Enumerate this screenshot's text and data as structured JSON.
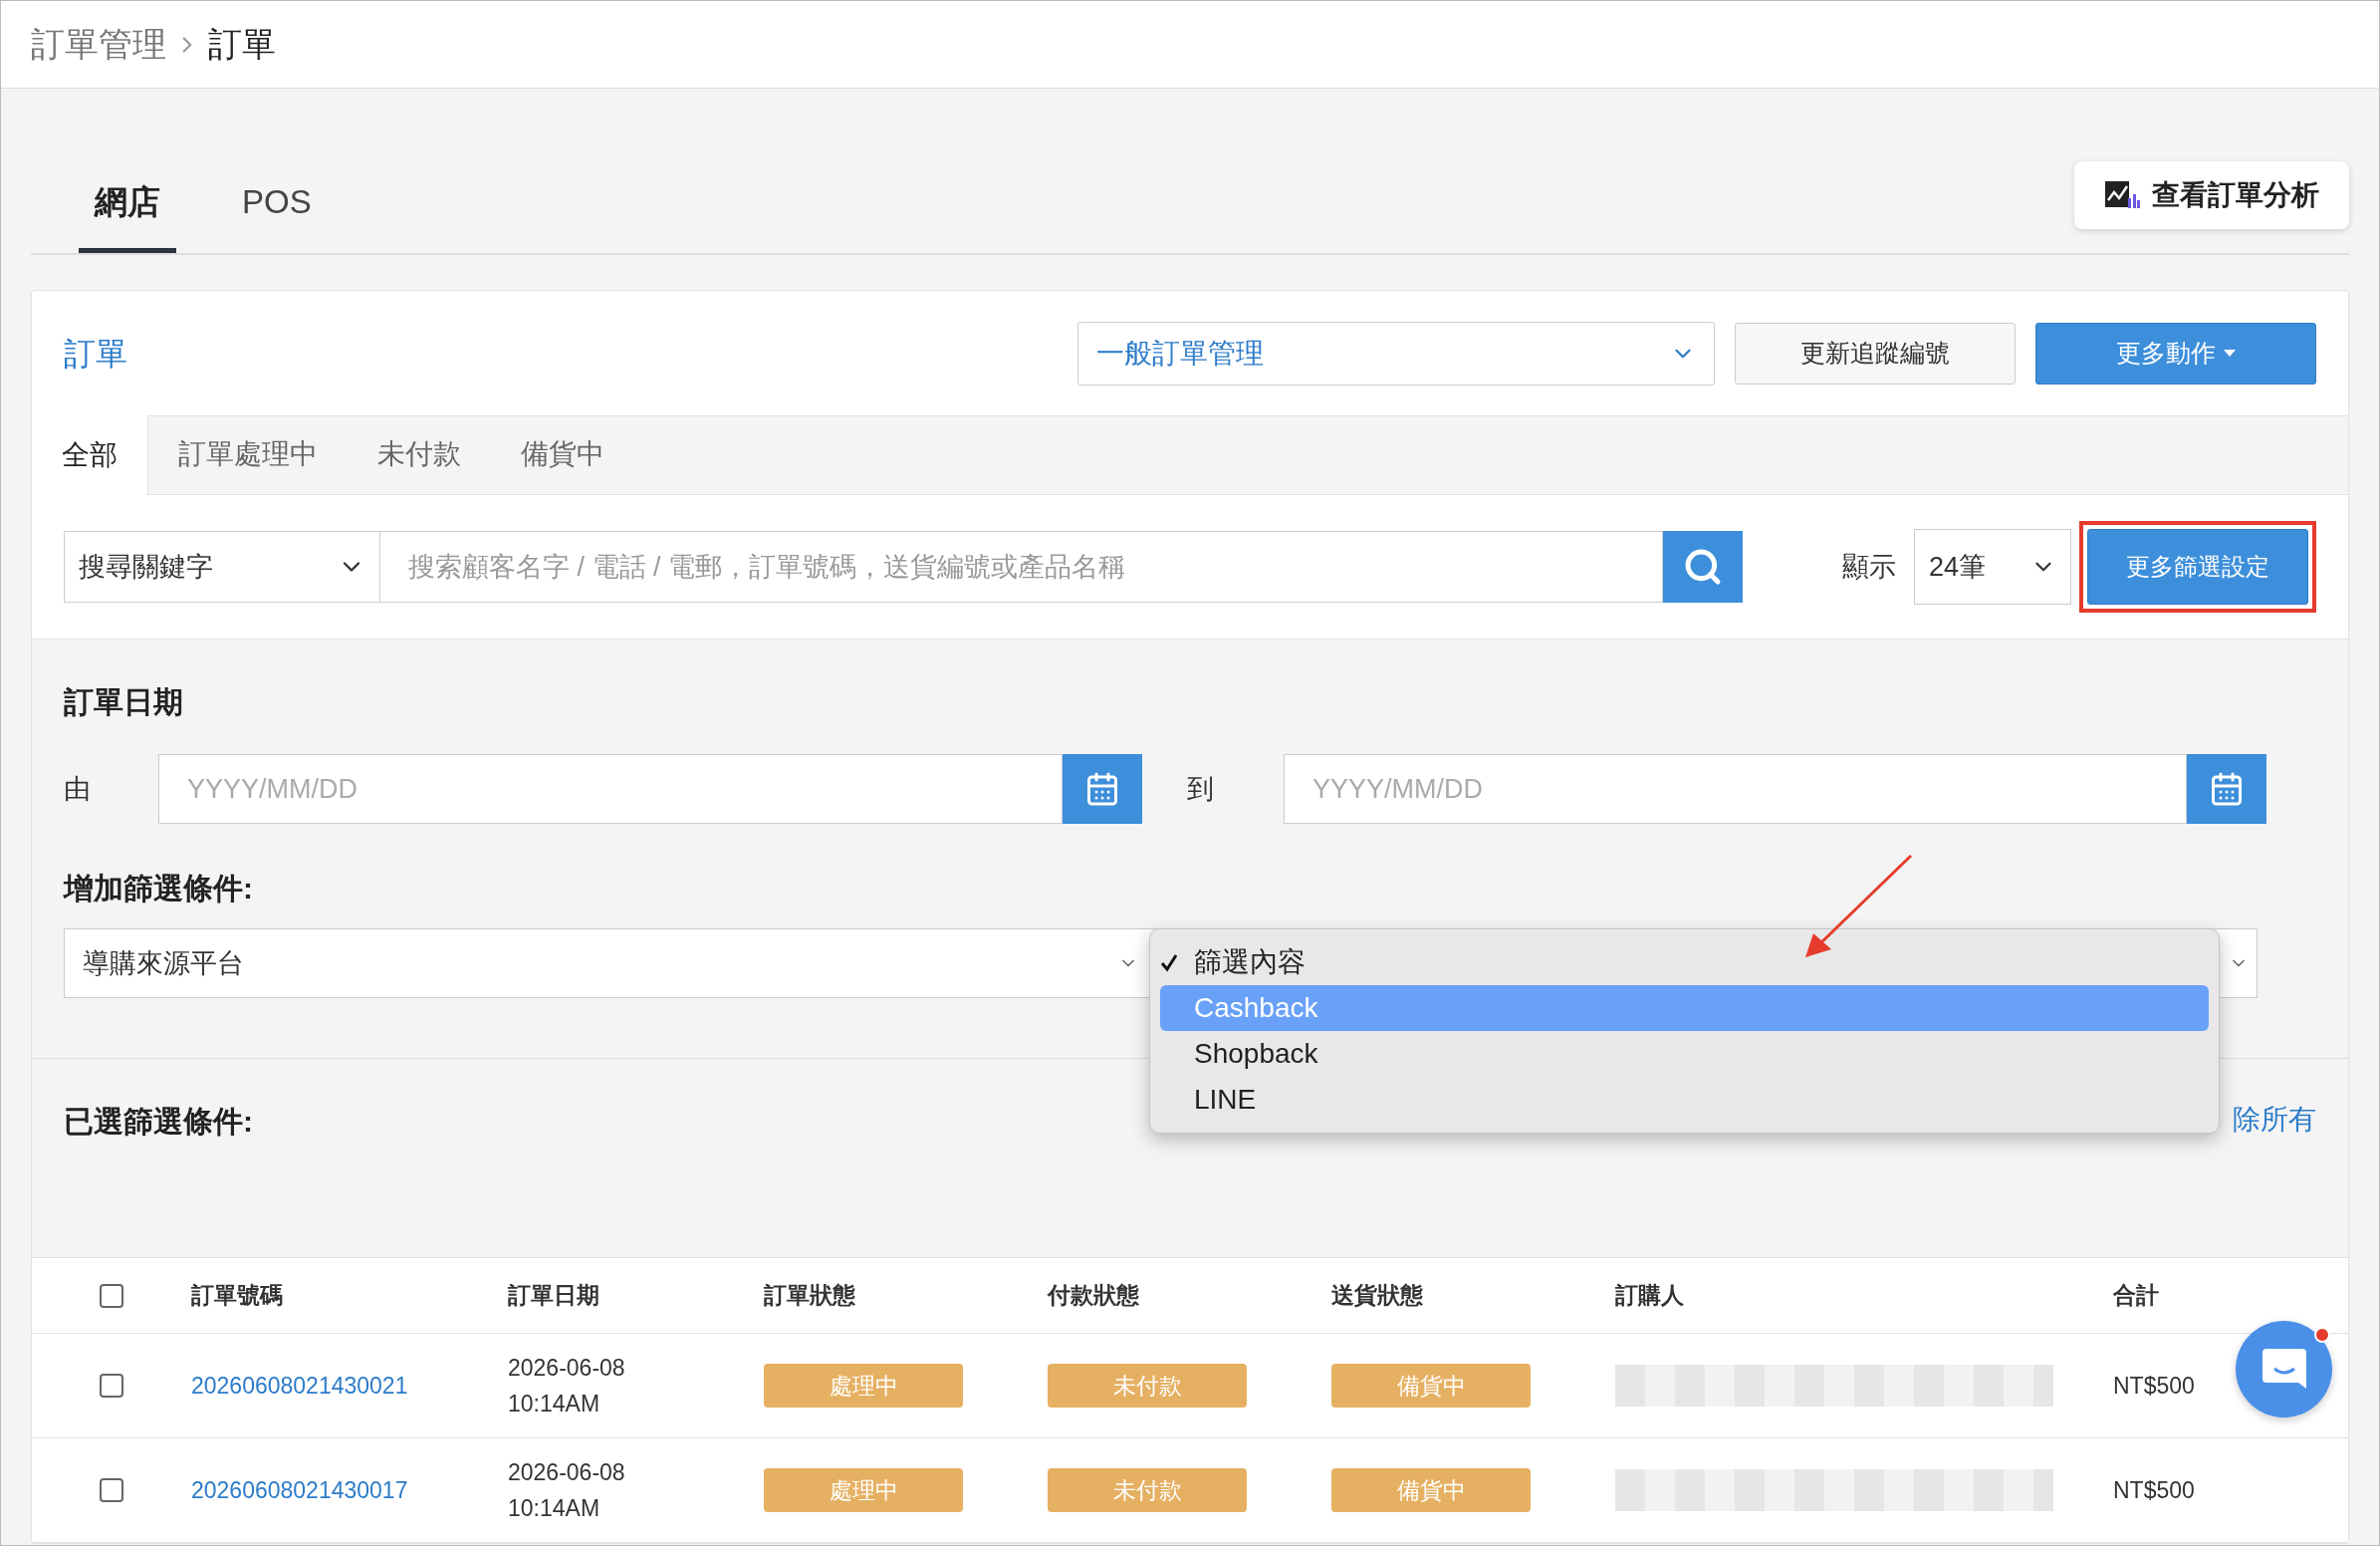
{
  "breadcrumb": {
    "parent": "訂單管理",
    "current": "訂單"
  },
  "main_tabs": [
    {
      "label": "網店",
      "selected": true
    },
    {
      "label": "POS",
      "selected": false
    }
  ],
  "analysis_button": "查看訂單分析",
  "orders_panel": {
    "title": "訂單",
    "view_select": "一般訂單管理",
    "buttons": [
      {
        "label": "更新追蹤編號",
        "kind": "default"
      },
      {
        "label": "更多動作",
        "kind": "primary"
      }
    ]
  },
  "status_tabs": [
    {
      "label": "全部",
      "selected": true
    },
    {
      "label": "訂單處理中",
      "selected": false
    },
    {
      "label": "未付款",
      "selected": false
    },
    {
      "label": "備貨中",
      "selected": false
    }
  ],
  "search": {
    "scope": "搜尋關鍵字",
    "placeholder": "搜索顧客名字 / 電話 / 電郵，訂單號碼，送貨編號或產品名稱",
    "show_label": "顯示",
    "page_size": "24筆",
    "more_filters": "更多篩選設定",
    "highlighted": true
  },
  "filters": {
    "date_title": "訂單日期",
    "from_label": "由",
    "from_placeholder": "YYYY/MM/DD",
    "to_label": "到",
    "to_placeholder": "YYYY/MM/DD",
    "add_title": "增加篩選條件:",
    "field": "導購來源平台",
    "menu": [
      {
        "label": "篩選內容",
        "checked": true,
        "selected": false
      },
      {
        "label": "Cashback",
        "checked": false,
        "selected": true
      },
      {
        "label": "Shopback",
        "checked": false,
        "selected": false
      },
      {
        "label": "LINE",
        "checked": false,
        "selected": false
      }
    ],
    "selected_title": "已選篩選條件:",
    "clear_link": "除所有"
  },
  "table": {
    "select_all_checked": false,
    "columns": [
      "訂單號碼",
      "訂單日期",
      "訂單狀態",
      "付款狀態",
      "送貨狀態",
      "訂購人",
      "合計"
    ],
    "rows": [
      {
        "checked": false,
        "order_no": "20260608021430021",
        "date": "2026-06-08",
        "time": "10:14AM",
        "order_status": "處理中",
        "payment_status": "未付款",
        "shipping_status": "備貨中",
        "total": "NT$500"
      },
      {
        "checked": false,
        "order_no": "20260608021430017",
        "date": "2026-06-08",
        "time": "10:14AM",
        "order_status": "處理中",
        "payment_status": "未付款",
        "shipping_status": "備貨中",
        "total": "NT$500"
      }
    ]
  }
}
